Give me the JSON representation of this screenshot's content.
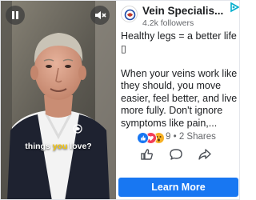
{
  "video": {
    "caption_before": "things ",
    "caption_highlight": "you",
    "caption_after": " love?",
    "play_icon": "pause-icon",
    "sound_icon": "mute-icon"
  },
  "page": {
    "name": "Vein Specialis...",
    "followers": "4.2k followers",
    "ad_choices_icon": "adchoices-icon"
  },
  "post": {
    "line1": "Healthy legs = a better life",
    "emoji_placeholder": "▯",
    "line2": "When your veins work like they should, you move easier, feel better, and live more fully. Don't ignore symptoms like pain,..."
  },
  "engagement": {
    "reaction_count": "9",
    "separator": "•",
    "shares": "2 Shares",
    "reaction_icons": [
      "like-reaction-icon",
      "love-reaction-icon",
      "wow-reaction-icon"
    ]
  },
  "actions": {
    "like_icon": "thumbs-up-icon",
    "comment_icon": "comment-icon",
    "share_icon": "share-icon"
  },
  "cta": {
    "label": "Learn More"
  },
  "colors": {
    "brand_blue": "#1877f2",
    "caption_highlight": "#f5c60a",
    "text_primary": "#1c1e21",
    "text_secondary": "#65676b"
  }
}
